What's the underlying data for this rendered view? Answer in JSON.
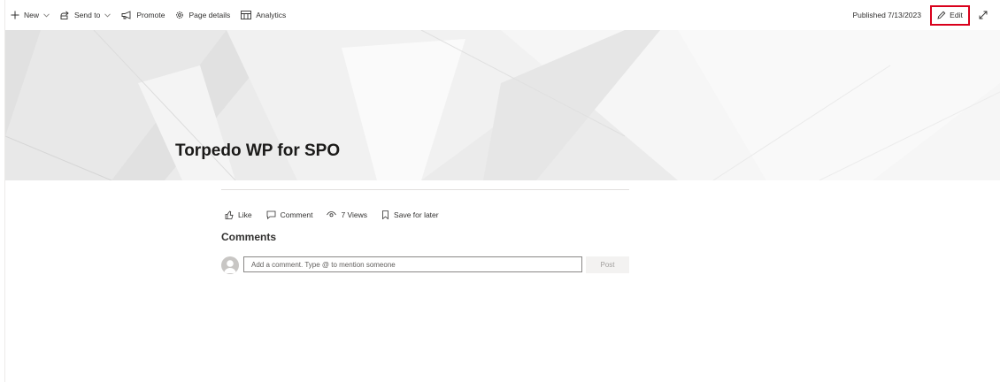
{
  "command_bar": {
    "new_label": "New",
    "send_to_label": "Send to",
    "promote_label": "Promote",
    "page_details_label": "Page details",
    "analytics_label": "Analytics",
    "published_text": "Published 7/13/2023",
    "edit_label": "Edit"
  },
  "page": {
    "title": "Torpedo WP for SPO"
  },
  "social": {
    "like_label": "Like",
    "comment_label": "Comment",
    "views_label": "7 Views",
    "save_label": "Save for later"
  },
  "comments": {
    "heading": "Comments",
    "placeholder": "Add a comment. Type @ to mention someone",
    "post_label": "Post"
  },
  "colors": {
    "highlight": "#d9001b",
    "text": "#323130"
  }
}
